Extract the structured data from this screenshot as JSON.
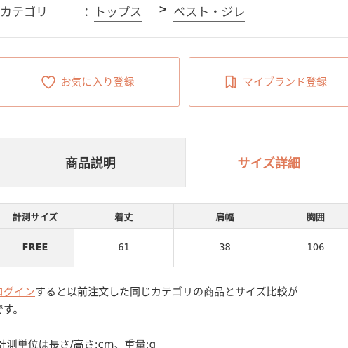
{
  "breadcrumb": {
    "label": "カテゴリ",
    "colon": "：",
    "items": [
      "トップス",
      "ベスト・ジレ"
    ],
    "separator": ">"
  },
  "actions": {
    "favorite_label": "お気に入り登録",
    "favorite_icon": "heart-icon",
    "brand_label": "マイブランド登録",
    "brand_icon": "bookmark-icon",
    "accent_color": "#e07b5a"
  },
  "tabs": [
    {
      "label": "商品説明",
      "active": false
    },
    {
      "label": "サイズ詳細",
      "active": true
    }
  ],
  "size_table": {
    "headers": [
      "計測サイズ",
      "着丈",
      "肩幅",
      "胸囲"
    ],
    "rows": [
      {
        "size": "FREE",
        "values": [
          "61",
          "38",
          "106"
        ]
      }
    ]
  },
  "note": {
    "link_text": "ログイン",
    "line1_rest": "すると以前注文した同じカテゴリの商品とサイズ比較が",
    "line2": "です。",
    "units": "※計測単位は長さ/高さ:cm、重量:g"
  }
}
